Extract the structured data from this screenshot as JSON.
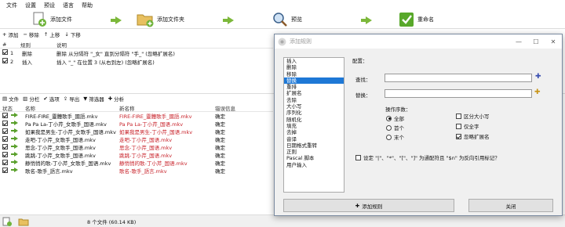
{
  "menu": [
    "文件",
    "设置",
    "预设",
    "语言",
    "帮助"
  ],
  "toolbar": {
    "add_files": "添加文件",
    "add_folder": "添加文件夹",
    "preview": "预览",
    "rename": "重命名"
  },
  "rules_toolbar": [
    "添加",
    "移除",
    "上移",
    "下移"
  ],
  "rules_header": {
    "num": "#",
    "rule": "规则",
    "desc": "说明"
  },
  "rules": [
    {
      "num": "1",
      "rule": "删除",
      "desc": "删除 从分隔符 \"_女\" 直到分隔符 \"手_\" (忽略扩展名)"
    },
    {
      "num": "2",
      "rule": "插入",
      "desc": "插入 \"_\" 在位置 3 (从右到左) (忽略扩展名)"
    }
  ],
  "files_toolbar": [
    "文件",
    "分栏",
    "选项",
    "导出",
    "筛选器",
    "分析"
  ],
  "files_header": {
    "status": "状态",
    "name": "名称",
    "new_name": "新名称",
    "error": "错误信息"
  },
  "files": [
    {
      "name": "FIRE-FIRE_靈體歌手_國語.mkv",
      "new_name": "FIRE-FIRE_靈體歌手_國語.mkv",
      "error": "确定",
      "changed": true
    },
    {
      "name": "Pa Pa La-丁小芹_女歌手_国语.mkv",
      "new_name": "Pa Pa La-丁小芹_国语.mkv",
      "error": "确定",
      "changed": true
    },
    {
      "name": "如果我是男生-丁小芹_女歌手_国语.mkv",
      "new_name": "如果我是男生-丁小芹_国语.mkv",
      "error": "确定",
      "changed": true
    },
    {
      "name": "走吧-丁小芹_女歌手_国语.mkv",
      "new_name": "走吧-丁小芹_国语.mkv",
      "error": "确定",
      "changed": true
    },
    {
      "name": "思念-丁小芹_女歌手_国语.mkv",
      "new_name": "思念-丁小芹_国语.mkv",
      "error": "确定",
      "changed": true
    },
    {
      "name": "跳跳-丁小芹_女歌手_国语.mkv",
      "new_name": "跳跳-丁小芹_国语.mkv",
      "error": "确定",
      "changed": true
    },
    {
      "name": "静悄悄的歌-丁小芹_女歌手_国语.mkv",
      "new_name": "静悄悄的歌-丁小芹_国语.mkv",
      "error": "确定",
      "changed": true
    },
    {
      "name": "歌名-歌手_語言.mkv",
      "new_name": "歌名-歌手_語言.mkv",
      "error": "确定",
      "changed": true
    }
  ],
  "status_text": "8 个文件 (60.14 KB)",
  "dialog": {
    "title": "添加规则",
    "config_label": "配置：",
    "rule_list": [
      "插入",
      "删除",
      "移除",
      "替换",
      "重排",
      "扩展名",
      "去除",
      "大小写",
      "序列化",
      "随机化",
      "填充",
      "去掉",
      "音译",
      "日期格式重转",
      "正则",
      "Pascal 脚本",
      "用户输入"
    ],
    "selected_index": 3,
    "find_label": "查找：",
    "replace_label": "替换：",
    "find_value": "",
    "replace_value": "",
    "order_label": "操作序数：",
    "order_options": [
      "全部",
      "首个",
      "末个"
    ],
    "order_selected": 0,
    "check_options": [
      {
        "label": "区分大小写",
        "checked": false
      },
      {
        "label": "仅全字",
        "checked": false
      },
      {
        "label": "忽略扩展名",
        "checked": true
      }
    ],
    "meta_label": "设定 \"|\"、\"*\"、\"[\"、\"]\" 为通配符且 \"$n\" 为反向引用标记？",
    "meta_checked": false,
    "add_button": "添加规则",
    "close_button": "关闭"
  },
  "colors": {
    "accent": "#1e78d6",
    "changed_text": "#c8222a",
    "arrow": "#5aa02c"
  }
}
